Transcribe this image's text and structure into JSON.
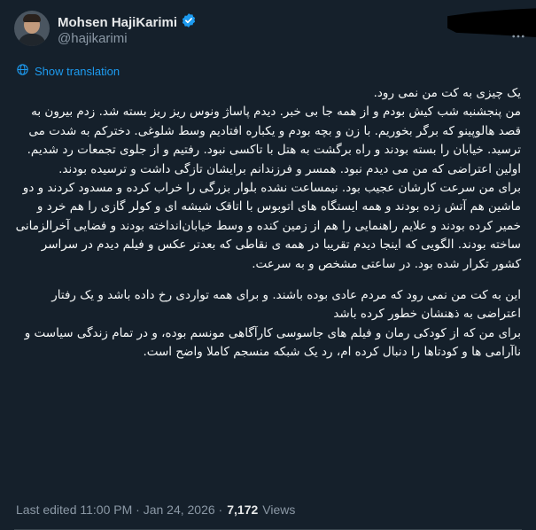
{
  "author": {
    "display_name": "Mohsen HajiKarimi",
    "handle": "@hajikarimi",
    "verified_badge_color": "#1d9bf0"
  },
  "translate_link": "Show translation",
  "tweet": {
    "p1": [
      "یک چیزی به کت من نمی رود.",
      "من پنجشنبه شب کیش بودم و از همه جا بی خبر. دیدم پاساژ ونوس ریز ریز بسته شد. زدم بیرون به قصد هالوپینو که برگر بخوریم.  با زن و بچه بودم و یکباره افتادیم وسط شلوغی. دخترکم به شدت می ترسید. خیابان را بسته بودند و راه برگشت به هتل با تاکسی نبود. رفتیم و از جلوی تجمعات رد شدیم.",
      "اولین اعتراضی که من می دیدم نبود. همسر و فرزندانم برایشان تازگی داشت و ترسیده بودند.",
      "برای من سرعت کارشان عجیب بود. نیمساعت نشده بلوار بزرگی را خراب کرده و مسدود کردند و دو ماشین هم آتش زده بودند و همه ایستگاه های اتوبوس با اتاقک شیشه ای و کولر گازی را هم خرد و خمیر کرده بودند و علایم راهنمایی را هم از زمین کنده و وسط خیابان‌انداخته بودند و  فضایی آخرالزمانی ساخته بودند.  الگویی که اینجا دیدم تقریبا در همه ی نقاطی که بعدتر عکس و فیلم دیدم در سراسر کشور تکرار شده بود. در ساعتی مشخص  و به سرعت."
    ],
    "p2": [
      "این به کت من نمی رود که مردم عادی بوده باشند. و برای همه تواردی رخ داده باشد و یک رفتار اعتراضی به ذهنشان خطور کرده باشد",
      " برای من که از کودکی رمان و فیلم های جاسوسی کارآگاهی مونسم بوده، و در تمام زندگی سیاست و ناآرامی ها و کودتاها را دنبال کرده ام، رد یک شبکه منسجم کاملا واضح است."
    ]
  },
  "meta": {
    "edited_label": "Last edited 11:00 PM · Jan 24, 2026 ·",
    "views_count": "7,172",
    "views_label": "Views"
  },
  "icons": {
    "verified": "verified-badge-icon",
    "translate": "globe-icon",
    "more": "more-options-icon"
  }
}
